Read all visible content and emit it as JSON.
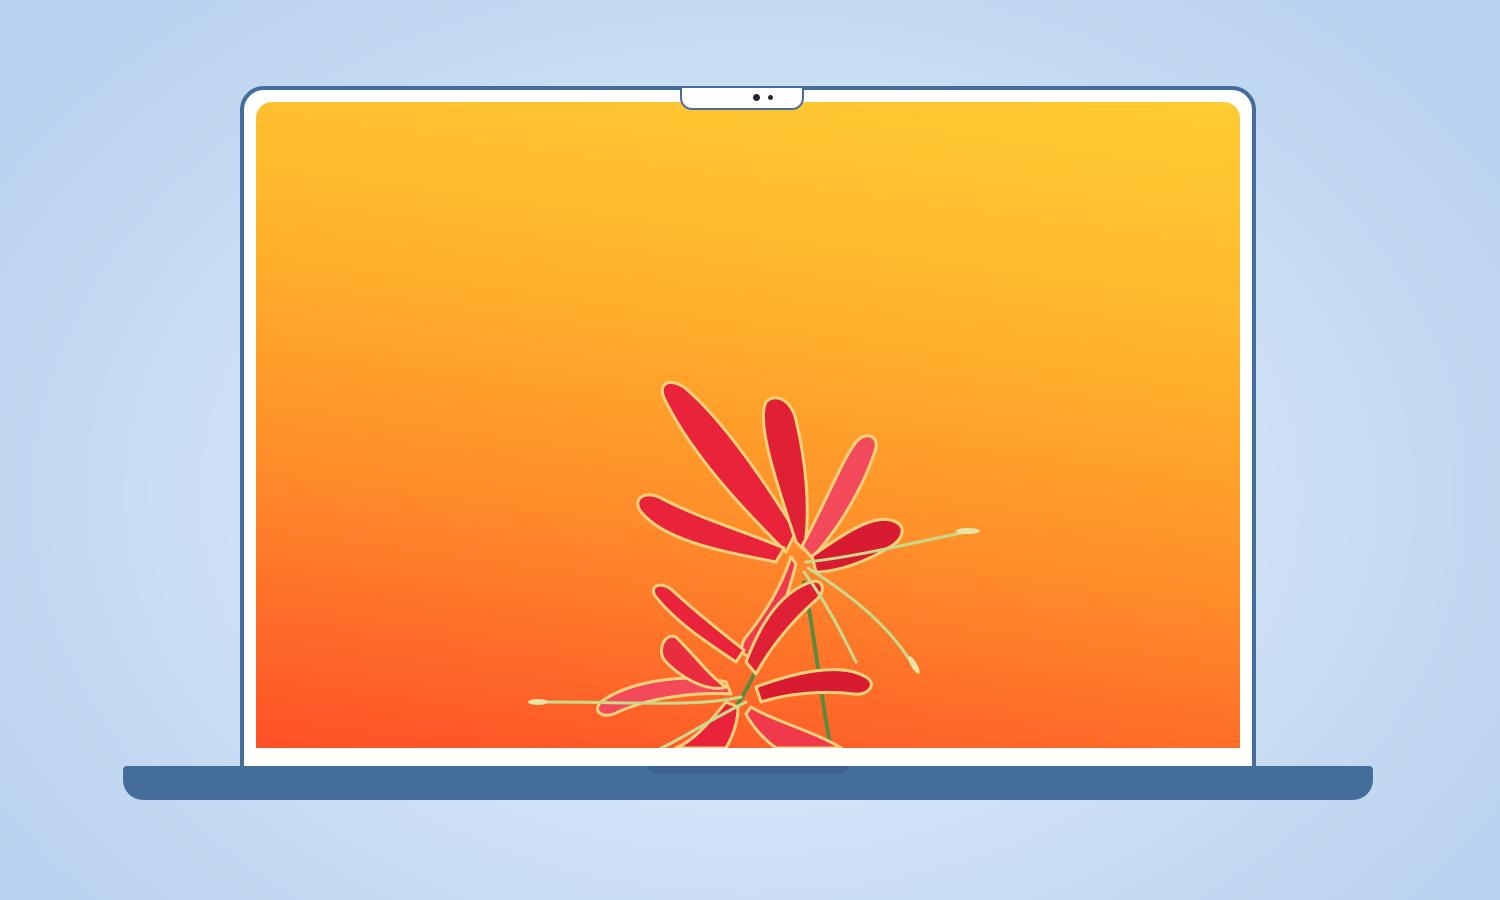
{
  "scene": {
    "type": "laptop-mockup",
    "background_colors": [
      "#eaf2fb",
      "#b9d2ef"
    ],
    "device_color": "#456d9b",
    "bezel_color": "#ffffff",
    "camera_icon": "camera-icon"
  },
  "wallpaper": {
    "subject": "red-lily-flower",
    "gradient_colors": [
      "#ffcc33",
      "#ff8f2a",
      "#ff5028"
    ],
    "flower_colors": {
      "petal": "#e8233a",
      "petal_highlight": "#f24a5a",
      "edge": "#f5d27a",
      "stamen": "#c9d98a"
    }
  }
}
